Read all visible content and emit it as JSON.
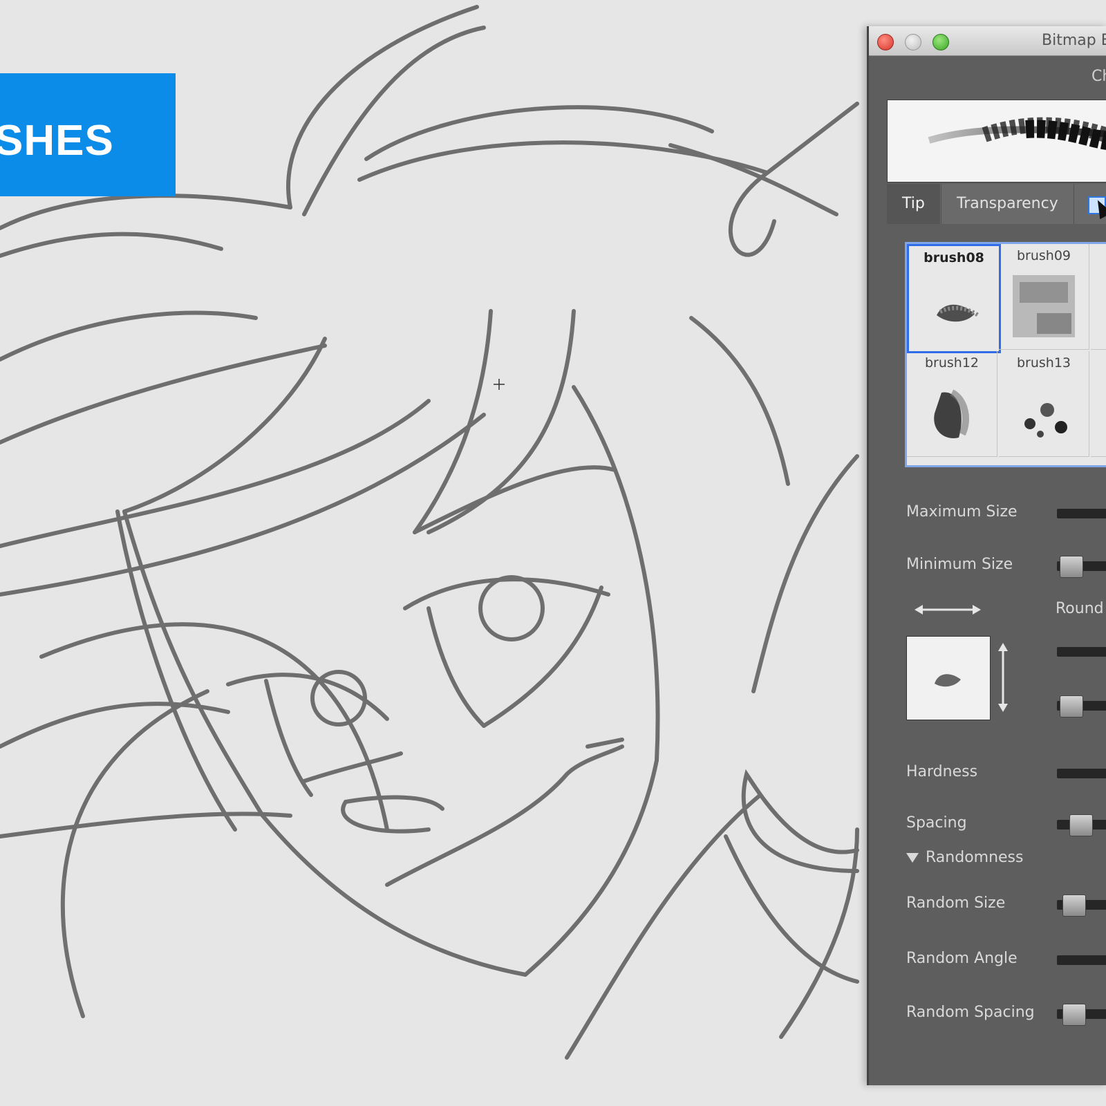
{
  "banner": {
    "text": "SHES",
    "color": "#0a8ce8"
  },
  "window": {
    "title": "Bitmap E",
    "subtitle": "Ch",
    "tabs": [
      {
        "label": "Tip"
      },
      {
        "label": "Transparency"
      }
    ],
    "brushes": [
      {
        "name": "brush08",
        "selected": true
      },
      {
        "name": "brush09",
        "selected": false
      },
      {
        "name": "brush12",
        "selected": false
      },
      {
        "name": "brush13",
        "selected": false
      }
    ],
    "controls": {
      "maximum_size": "Maximum Size",
      "minimum_size": "Minimum Size",
      "roundness": "Round",
      "hardness": "Hardness",
      "spacing": "Spacing",
      "randomness_section": "Randomness",
      "random_size": "Random Size",
      "random_angle": "Random Angle",
      "random_spacing": "Random Spacing"
    }
  }
}
